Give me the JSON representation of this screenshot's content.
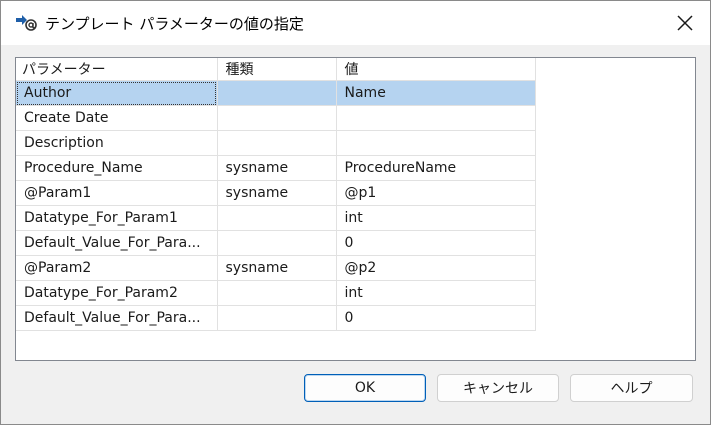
{
  "window": {
    "title": "テンプレート パラメーターの値の指定",
    "icon": "template-parameter-icon",
    "close_icon": "close-icon"
  },
  "grid": {
    "columns": [
      "パラメーター",
      "種類",
      "値"
    ],
    "rows": [
      {
        "param": "Author",
        "type": "",
        "value": "Name",
        "selected": true
      },
      {
        "param": "Create Date",
        "type": "",
        "value": ""
      },
      {
        "param": "Description",
        "type": "",
        "value": ""
      },
      {
        "param": "Procedure_Name",
        "type": "sysname",
        "value": "ProcedureName"
      },
      {
        "param": "@Param1",
        "type": "sysname",
        "value": "@p1"
      },
      {
        "param": "Datatype_For_Param1",
        "type": "",
        "value": "int"
      },
      {
        "param": "Default_Value_For_Para...",
        "type": "",
        "value": "0"
      },
      {
        "param": "@Param2",
        "type": "sysname",
        "value": "@p2"
      },
      {
        "param": "Datatype_For_Param2",
        "type": "",
        "value": "int"
      },
      {
        "param": "Default_Value_For_Para...",
        "type": "",
        "value": "0"
      }
    ]
  },
  "buttons": {
    "ok": "OK",
    "cancel": "キャンセル",
    "help": "ヘルプ"
  }
}
